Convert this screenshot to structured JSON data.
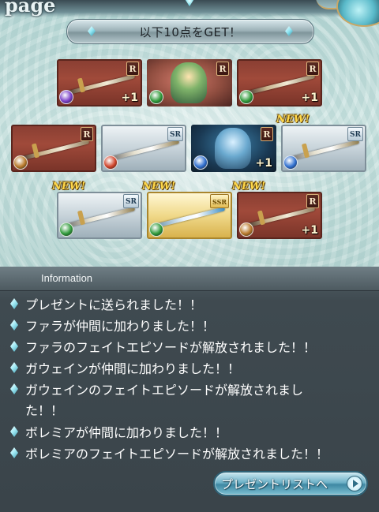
{
  "header": {
    "page_label": "page",
    "get_banner": "以下10点をGET！"
  },
  "items": [
    {
      "rarity": "R",
      "kind": "weapon",
      "element": "dark",
      "element_color": "#7a3fc8",
      "plus": "+1",
      "new": ""
    },
    {
      "rarity": "R",
      "kind": "character",
      "element": "wind",
      "element_color": "#2f9a3a",
      "plus": "",
      "new": ""
    },
    {
      "rarity": "R",
      "kind": "weapon",
      "element": "wind",
      "element_color": "#2f9a3a",
      "plus": "+1",
      "new": ""
    },
    {
      "rarity": "R",
      "kind": "weapon",
      "element": "earth",
      "element_color": "#b9792a",
      "plus": "",
      "new": ""
    },
    {
      "rarity": "SR",
      "kind": "weapon",
      "element": "fire",
      "element_color": "#d0432a",
      "plus": "",
      "new": ""
    },
    {
      "rarity": "R",
      "kind": "character",
      "element": "water",
      "element_color": "#2f6fd0",
      "plus": "+1",
      "new": ""
    },
    {
      "rarity": "SR",
      "kind": "weapon",
      "element": "water",
      "element_color": "#2f6fd0",
      "plus": "",
      "new": "NEW!"
    },
    {
      "rarity": "SR",
      "kind": "weapon",
      "element": "wind",
      "element_color": "#2f9a3a",
      "plus": "",
      "new": "NEW!"
    },
    {
      "rarity": "SSR",
      "kind": "weapon",
      "element": "wind",
      "element_color": "#2f9a3a",
      "plus": "",
      "new": "NEW!"
    },
    {
      "rarity": "R",
      "kind": "weapon",
      "element": "earth",
      "element_color": "#b9792a",
      "plus": "+1",
      "new": "NEW!"
    }
  ],
  "information": {
    "title": "Information",
    "messages": [
      "プレゼントに送られました！！",
      "ファラが仲間に加わりました！！",
      "ファラのフェイトエピソードが解放されました！！",
      "ガウェインが仲間に加わりました！！",
      "ガウェインのフェイトエピソードが解放されまし",
      "ボレミアが仲間に加わりました！！",
      "ボレミアのフェイトエピソードが解放されました！！"
    ],
    "message_continuation": "た！！"
  },
  "present_button": {
    "label": "プレゼントリストへ",
    "icon": "arrow-right-circle-icon"
  }
}
